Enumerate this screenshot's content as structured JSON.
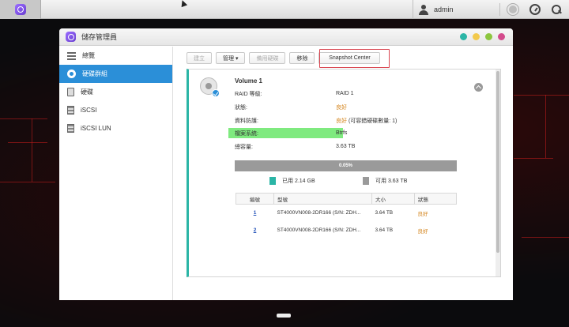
{
  "taskbar": {
    "user_name": "admin",
    "icons": [
      "app-launcher-icon",
      "user-icon",
      "notification-icon",
      "dashboard-icon",
      "search-icon"
    ]
  },
  "window": {
    "title": "儲存管理員",
    "dots": [
      "#2bb5a6",
      "#f2c94c",
      "#8cc63f",
      "#d34b8c"
    ]
  },
  "sidebar": {
    "items": [
      {
        "label": "總覽",
        "icon": "overview-icon",
        "active": false
      },
      {
        "label": "硬碟群組",
        "icon": "disk-group-icon",
        "active": true
      },
      {
        "label": "硬碟",
        "icon": "disk-icon",
        "active": false
      },
      {
        "label": "iSCSI",
        "icon": "iscsi-icon",
        "active": false
      },
      {
        "label": "iSCSI LUN",
        "icon": "iscsi-lun-icon",
        "active": false
      }
    ]
  },
  "toolbar": {
    "create": "建立",
    "manage": "管理 ▾",
    "replace_disk": "備用硬碟",
    "remove": "移除",
    "snapshot_center": "Snapshot Center"
  },
  "volume": {
    "name": "Volume 1",
    "raid_label": "RAID 等級:",
    "raid_value": "RAID 1",
    "status_label": "狀態:",
    "status_value": "良好",
    "protection_label": "資料防護:",
    "protection_value": "良好 (可容錯硬碟數量: 1)",
    "fs_label": "檔案系統:",
    "fs_value": "Btrfs",
    "capacity_label": "總容量:",
    "capacity_value": "3.63 TB",
    "usage_percent": "0.05%",
    "used_label": "已用 2.14 GB",
    "free_label": "可用 3.63 TB",
    "used_color": "#2bb5a6",
    "free_color": "#9a9a9a"
  },
  "disk_table": {
    "headers": [
      "編號",
      "型號",
      "大小",
      "狀態"
    ],
    "rows": [
      {
        "no": "1",
        "model": "ST4000VN008-2DR166 (S/N: ZDH...",
        "size": "3.64 TB",
        "status": "良好"
      },
      {
        "no": "2",
        "model": "ST4000VN008-2DR166 (S/N: ZDH...",
        "size": "3.64 TB",
        "status": "良好"
      }
    ]
  }
}
